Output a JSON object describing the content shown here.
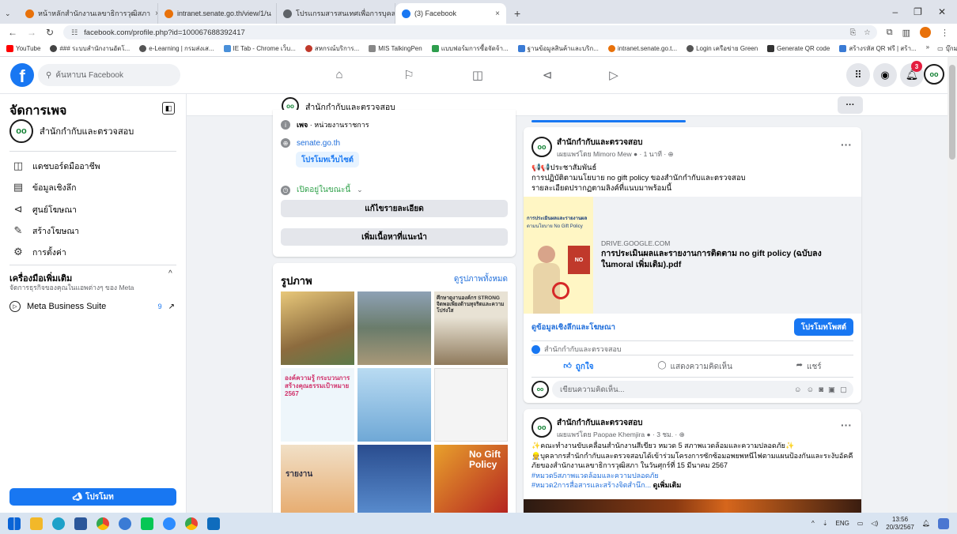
{
  "browser": {
    "tabs": [
      {
        "title": "หน้าหลักสำนักงานเลขาธิการวุฒิสภา",
        "color": "#e8710a"
      },
      {
        "title": "intranet.senate.go.th/view/1/น",
        "color": "#e8710a"
      },
      {
        "title": "โปรแกรมสารสนเทศเพื่อการบุคลล",
        "color": "#5f6368"
      },
      {
        "title": "(3) Facebook",
        "color": "#1877f2"
      }
    ],
    "url": "facebook.com/profile.php?id=100067688392417",
    "bookmarks": [
      {
        "label": "YouTube",
        "color": "#ff0000"
      },
      {
        "label": "### ระบบสำนักงานอัตโ...",
        "color": "#444444"
      },
      {
        "label": "e-Learning | กรมส่งเส...",
        "color": "#555555"
      },
      {
        "label": "IE Tab - Chrome เว็บ...",
        "color": "#4a90d9"
      },
      {
        "label": "สหกรณ์บริการ...",
        "color": "#c0392b"
      },
      {
        "label": "MIS TalkingPen",
        "color": "#888888"
      },
      {
        "label": "แบบฟอร์มการซื้อจัดจ้า...",
        "color": "#2e9e4d"
      },
      {
        "label": "ฐานข้อมูลสินค้าและบริก...",
        "color": "#3a7bd5"
      },
      {
        "label": "intranet.senate.go.t...",
        "color": "#e8710a"
      },
      {
        "label": "Login เครือข่าย Green",
        "color": "#555555"
      },
      {
        "label": "Generate QR code",
        "color": "#333333"
      },
      {
        "label": "สร้างรหัส QR ฟรี | สร้า...",
        "color": "#3a7bd5"
      }
    ],
    "bookmarks_folder": "บุ๊กมาร์กทั้งหมด"
  },
  "fbnav": {
    "search_placeholder": "ค้นหาบน Facebook",
    "notification_count": "3"
  },
  "sidebar": {
    "title": "จัดการเพจ",
    "page_name": "สำนักกำกับและตรวจสอบ",
    "items": [
      {
        "label": "แดชบอร์ดมืออาชีพ",
        "icon": "dashboard-icon",
        "glyph": "◫"
      },
      {
        "label": "ข้อมูลเชิงลึก",
        "icon": "insights-icon",
        "glyph": "▤"
      },
      {
        "label": "ศูนย์โฆษณา",
        "icon": "ad-center-icon",
        "glyph": "⊲"
      },
      {
        "label": "สร้างโฆษณา",
        "icon": "create-ad-icon",
        "glyph": "✎"
      },
      {
        "label": "การตั้งค่า",
        "icon": "settings-icon",
        "glyph": "⚙"
      }
    ],
    "tools_title": "เครื่องมือเพิ่มเติม",
    "tools_subtitle": "จัดการธุรกิจของคุณในแอพต่างๆ ของ Meta",
    "meta_suite": "Meta Business Suite",
    "meta_suite_count": "9",
    "promote_label": "โปรโมท"
  },
  "pagebar": {
    "name": "สำนักกำกับและตรวจสอบ",
    "more": "···"
  },
  "intro": {
    "category_label": "เพจ",
    "category": "หน่วยงานราชการ",
    "website": "senate.go.th",
    "promote_website": "โปรโมทเว็บไซต์",
    "open_now": "เปิดอยู่ในขณะนี้",
    "edit_details": "แก้ไขรายละเอียด",
    "add_featured": "เพิ่มเนื้อหาที่แนะนำ"
  },
  "photos": {
    "title": "รูปภาพ",
    "see_all": "ดูรูปภาพทั้งหมด",
    "tiles": [
      {
        "caption": "",
        "bg": "#c9a66b"
      },
      {
        "caption": "",
        "bg": "#7b8a99"
      },
      {
        "caption": "ศึกษาดูงานองค์กร STRONG จิตพอเพียงต้านทุจริตและความโปร่งใส",
        "bg": "#d8d2c8"
      },
      {
        "caption": "องค์ความรู้ กระบวนการสร้างคุณธรรมเป้าหมาย 2567",
        "bg": "#eef6fb"
      },
      {
        "caption": "",
        "bg": "#9ec8e8"
      },
      {
        "caption": "",
        "bg": "#f4f4f4"
      },
      {
        "caption": "รายงาน",
        "bg": "#f1e0c7"
      },
      {
        "caption": "",
        "bg": "#2a4d8f"
      },
      {
        "caption": "No Gift Policy",
        "bg": "#b32020"
      }
    ]
  },
  "post1": {
    "page_name": "สำนักกำกับและตรวจสอบ",
    "published_by": "เผยแพร่โดย Mimoro Mew",
    "time": "1 นาที",
    "text_lines": [
      "📢📢ประชาสัมพันธ์",
      "การปฏิบัติตามนโยบาย no gift policy ของสำนักกำกับและตรวจสอบ",
      "รายละเอียดปรากฏตามลิงค์ที่แนบมาพร้อมนี้"
    ],
    "thumb_heading": "การประเมินผลและรายงานผล",
    "thumb_sub": "ตามนโยบาย No Gift Policy",
    "link_domain": "DRIVE.GOOGLE.COM",
    "link_title": "การประเมินผลและรายงานการติดตาม no gift policy (ฉบับลงในmoral เพิ่มเติม).pdf",
    "insights": "ดูข้อมูลเชิงลึกและโฆษณา",
    "boost": "โปรโมทโพสต์",
    "reactor": "สำนักกำกับและตรวจสอบ",
    "like": "ถูกใจ",
    "comment": "แสดงความคิดเห็น",
    "share": "แชร์",
    "comment_placeholder": "เขียนความคิดเห็น..."
  },
  "post2": {
    "page_name": "สำนักกำกับและตรวจสอบ",
    "published_by": "เผยแพร่โดย Paopae Khemjira",
    "time": "3 ชม.",
    "text_lines": [
      "✨คณะทำงานขับเคลื่อนสำนักงานสีเขียว หมวด 5 สภาพแวดล้อมและความปลอดภัย✨",
      "👷บุคลากรสำนักกำกับและตรวจสอบได้เข้าร่วมโครงการซักซ้อมอพยพหนีไฟตามแผนป้องกันและระงับอัคคี",
      "ภัยของสำนักงานเลขาธิการวุฒิสภา ในวันศุกร์ที่ 15 มีนาคม 2567"
    ],
    "hashtag1": "#หมวด5สภาพแวดล้อมและความปลอดภัย",
    "hashtag2": "#หมวด2การสื่อสารและสร้างจิตสำนึก...",
    "see_more": "ดูเพิ่มเติม"
  },
  "taskbar": {
    "lang": "ENG",
    "time": "13:56",
    "date": "20/3/2567"
  }
}
